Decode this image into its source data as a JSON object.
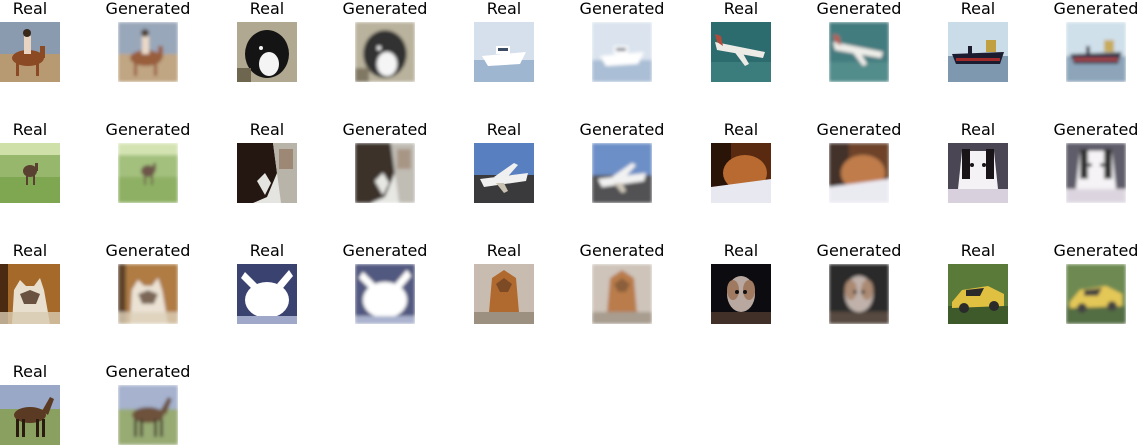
{
  "figure": {
    "pairs": [
      {
        "real_label": "Real",
        "generated_label": "Generated",
        "subject": "horse-rider",
        "palette": {
          "bg": "#8a9bb0",
          "ground": "#b89a72",
          "main": "#8b4a24",
          "accent": "#e8d4c0"
        }
      },
      {
        "real_label": "Real",
        "generated_label": "Generated",
        "subject": "dog",
        "palette": {
          "bg": "#b0a890",
          "ground": "#6f6650",
          "main": "#141414",
          "accent": "#f4f4f4"
        }
      },
      {
        "real_label": "Real",
        "generated_label": "Generated",
        "subject": "boat",
        "palette": {
          "bg": "#d6e0ec",
          "ground": "#9fb6d0",
          "main": "#ffffff",
          "accent": "#3c4c64"
        }
      },
      {
        "real_label": "Real",
        "generated_label": "Generated",
        "subject": "airplane",
        "palette": {
          "bg": "#2c6b6e",
          "ground": "#3b7d7c",
          "main": "#ecebe6",
          "accent": "#b04a3a"
        }
      },
      {
        "real_label": "Real",
        "generated_label": "Generated",
        "subject": "ship",
        "palette": {
          "bg": "#c9dce8",
          "ground": "#7e98b0",
          "main": "#1c1c30",
          "accent": "#c0a040"
        }
      },
      {
        "real_label": "Real",
        "generated_label": "Generated",
        "subject": "deer",
        "palette": {
          "bg": "#97b86c",
          "ground": "#7fa650",
          "main": "#5a4030",
          "accent": "#cfe0a8"
        }
      },
      {
        "real_label": "Real",
        "generated_label": "Generated",
        "subject": "horse-closeup",
        "palette": {
          "bg": "#e4e4e0",
          "ground": "#b8b4aa",
          "main": "#241610",
          "accent": "#8a6a52"
        }
      },
      {
        "real_label": "Real",
        "generated_label": "Generated",
        "subject": "airplane-ground",
        "palette": {
          "bg": "#5880c0",
          "ground": "#3a3a3c",
          "main": "#f0f0f0",
          "accent": "#c8c0b0"
        }
      },
      {
        "real_label": "Real",
        "generated_label": "Generated",
        "subject": "cat-sleeping",
        "palette": {
          "bg": "#5a2a10",
          "ground": "#e8e8f0",
          "main": "#b86a30",
          "accent": "#2a1408"
        }
      },
      {
        "real_label": "Real",
        "generated_label": "Generated",
        "subject": "dog-white",
        "palette": {
          "bg": "#4a4654",
          "ground": "#d8d0dc",
          "main": "#f4f2f4",
          "accent": "#181418"
        }
      },
      {
        "real_label": "Real",
        "generated_label": "Generated",
        "subject": "cat-sitting",
        "palette": {
          "bg": "#a56a2a",
          "ground": "#d8cbb0",
          "main": "#e9dfcf",
          "accent": "#4a2a10"
        }
      },
      {
        "real_label": "Real",
        "generated_label": "Generated",
        "subject": "white-animal",
        "palette": {
          "bg": "#3a4270",
          "ground": "#9fa8c8",
          "main": "#ffffff",
          "accent": "#c8ccd8"
        }
      },
      {
        "real_label": "Real",
        "generated_label": "Generated",
        "subject": "dog-brown",
        "palette": {
          "bg": "#c8bcb0",
          "ground": "#9c9080",
          "main": "#b06a30",
          "accent": "#7c4a24"
        }
      },
      {
        "real_label": "Real",
        "generated_label": "Generated",
        "subject": "dog-dark",
        "palette": {
          "bg": "#0c0c10",
          "ground": "#403028",
          "main": "#b8a8a0",
          "accent": "#a07a60"
        }
      },
      {
        "real_label": "Real",
        "generated_label": "Generated",
        "subject": "car",
        "palette": {
          "bg": "#5a7a3a",
          "ground": "#3e5a2a",
          "main": "#e0c040",
          "accent": "#2a2a2a"
        }
      },
      {
        "real_label": "Real",
        "generated_label": "Generated",
        "subject": "horse-standing",
        "palette": {
          "bg": "#9aa8c8",
          "ground": "#8aa060",
          "main": "#5a3a22",
          "accent": "#2a1a10"
        }
      }
    ]
  }
}
